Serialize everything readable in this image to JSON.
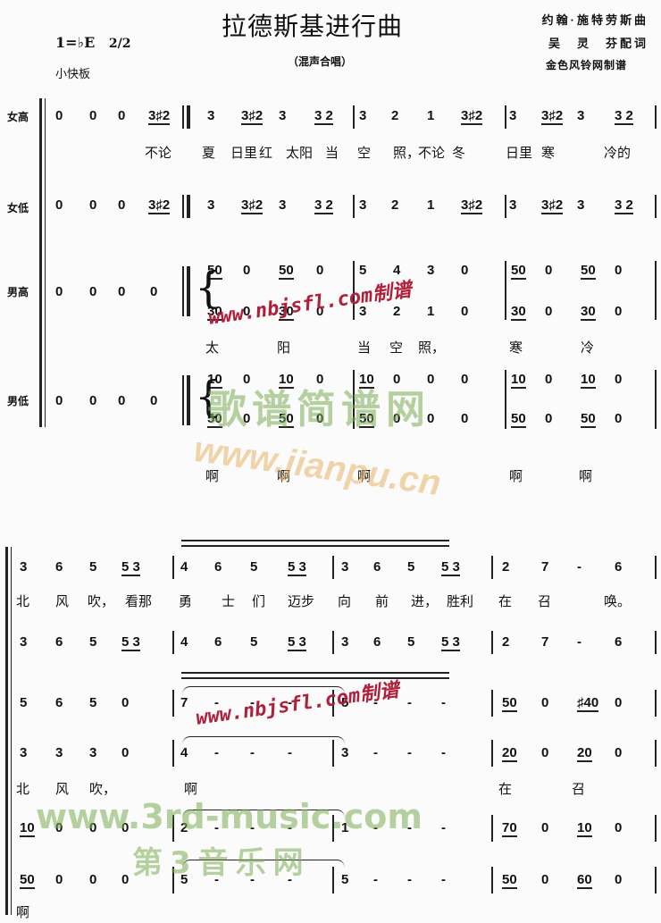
{
  "header": {
    "title": "拉德斯基进行曲",
    "subtitle": "（混声合唱）",
    "composer": "约翰·施特劳斯曲",
    "lyricist": "吴　灵　芬配词",
    "transcriber": "金色风铃网制谱",
    "key": "1=♭E",
    "time_signature": "2/2",
    "tempo": "小快板"
  },
  "voices": [
    "女高",
    "女低",
    "男高",
    "男低"
  ],
  "system1": {
    "soprano": [
      "0",
      "0",
      "0",
      "3♯2",
      "3",
      "3♯2",
      "3",
      "3 2",
      "3",
      "2",
      "1",
      "3♯2",
      "3",
      "3♯2",
      "3",
      "3 2"
    ],
    "soprano_lyrics": [
      "不论",
      "夏",
      "日里",
      "红",
      "太阳",
      "当",
      "空",
      "照，",
      "不论",
      "冬",
      "日里",
      "寒",
      "冷的"
    ],
    "alto": [
      "0",
      "0",
      "0",
      "3♯2",
      "3",
      "3♯2",
      "3",
      "3 2",
      "3",
      "2",
      "1",
      "3♯2",
      "3",
      "3♯2",
      "3",
      "3 2"
    ],
    "tenor_rest": [
      "0",
      "0",
      "0",
      "0"
    ],
    "tenor_upper": [
      "50",
      "0",
      "50",
      "0",
      "5",
      "4",
      "3",
      "0",
      "50",
      "0",
      "50",
      "0"
    ],
    "tenor_lower": [
      "30",
      "0",
      "30",
      "0",
      "3",
      "2",
      "1",
      "0",
      "30",
      "0",
      "30",
      "0"
    ],
    "tenor_lyrics": [
      "太",
      "阳",
      "当",
      "空",
      "照，",
      "寒",
      "冷"
    ],
    "bass_rest": [
      "0",
      "0",
      "0",
      "0"
    ],
    "bass_upper": [
      "10",
      "0",
      "10",
      "0",
      "10",
      "0",
      "0",
      "0",
      "10",
      "0",
      "10",
      "0"
    ],
    "bass_lower": [
      "50",
      "0",
      "50",
      "0",
      "50",
      "0",
      "0",
      "0",
      "50",
      "0",
      "50",
      "0"
    ],
    "bass_lyrics": [
      "啊",
      "啊",
      "啊",
      "啊",
      "啊"
    ]
  },
  "system2": {
    "soprano": [
      "3",
      "6",
      "5",
      "5 3",
      "4",
      "6",
      "5",
      "5 3",
      "3",
      "6",
      "5",
      "5 3",
      "2",
      "7",
      "-",
      "6"
    ],
    "soprano_lyrics": [
      "北",
      "风",
      "吹，",
      "看那",
      "勇",
      "士",
      "们",
      "迈步",
      "向",
      "前",
      "进，",
      "胜利",
      "在",
      "召",
      "唤。"
    ],
    "alto": [
      "3",
      "6",
      "5",
      "5 3",
      "4",
      "6",
      "5",
      "5 3",
      "3",
      "6",
      "5",
      "5 3",
      "2",
      "7",
      "-",
      "6"
    ],
    "tenor_upper": [
      "5",
      "6",
      "5",
      "0",
      "7",
      "-",
      "-",
      "-",
      "5",
      "-",
      "-",
      "-",
      "50",
      "0",
      "♯40",
      "0"
    ],
    "tenor_lower": [
      "3",
      "3",
      "3",
      "0",
      "4",
      "-",
      "-",
      "-",
      "3",
      "-",
      "-",
      "-",
      "20",
      "0",
      "20",
      "0"
    ],
    "tenor_lyrics": [
      "北",
      "风",
      "吹，",
      "啊",
      "在",
      "召"
    ],
    "bass_upper": [
      "10",
      "0",
      "0",
      "0",
      "2",
      "-",
      "-",
      "-",
      "1",
      "-",
      "-",
      "-",
      "70",
      "0",
      "10",
      "0"
    ],
    "bass_lower": [
      "50",
      "0",
      "0",
      "0",
      "5",
      "-",
      "-",
      "-",
      "5",
      "-",
      "-",
      "-",
      "50",
      "0",
      "60",
      "0"
    ],
    "bass_lyrics": [
      "啊"
    ]
  },
  "watermarks": {
    "red_url": "www.nbjsfl.com制谱",
    "green_cn": "歌谱简谱网",
    "orange_url": "www.jianpu.cn",
    "green_url": "www.3rd-music.com",
    "green_cn2": "第3音乐网"
  }
}
